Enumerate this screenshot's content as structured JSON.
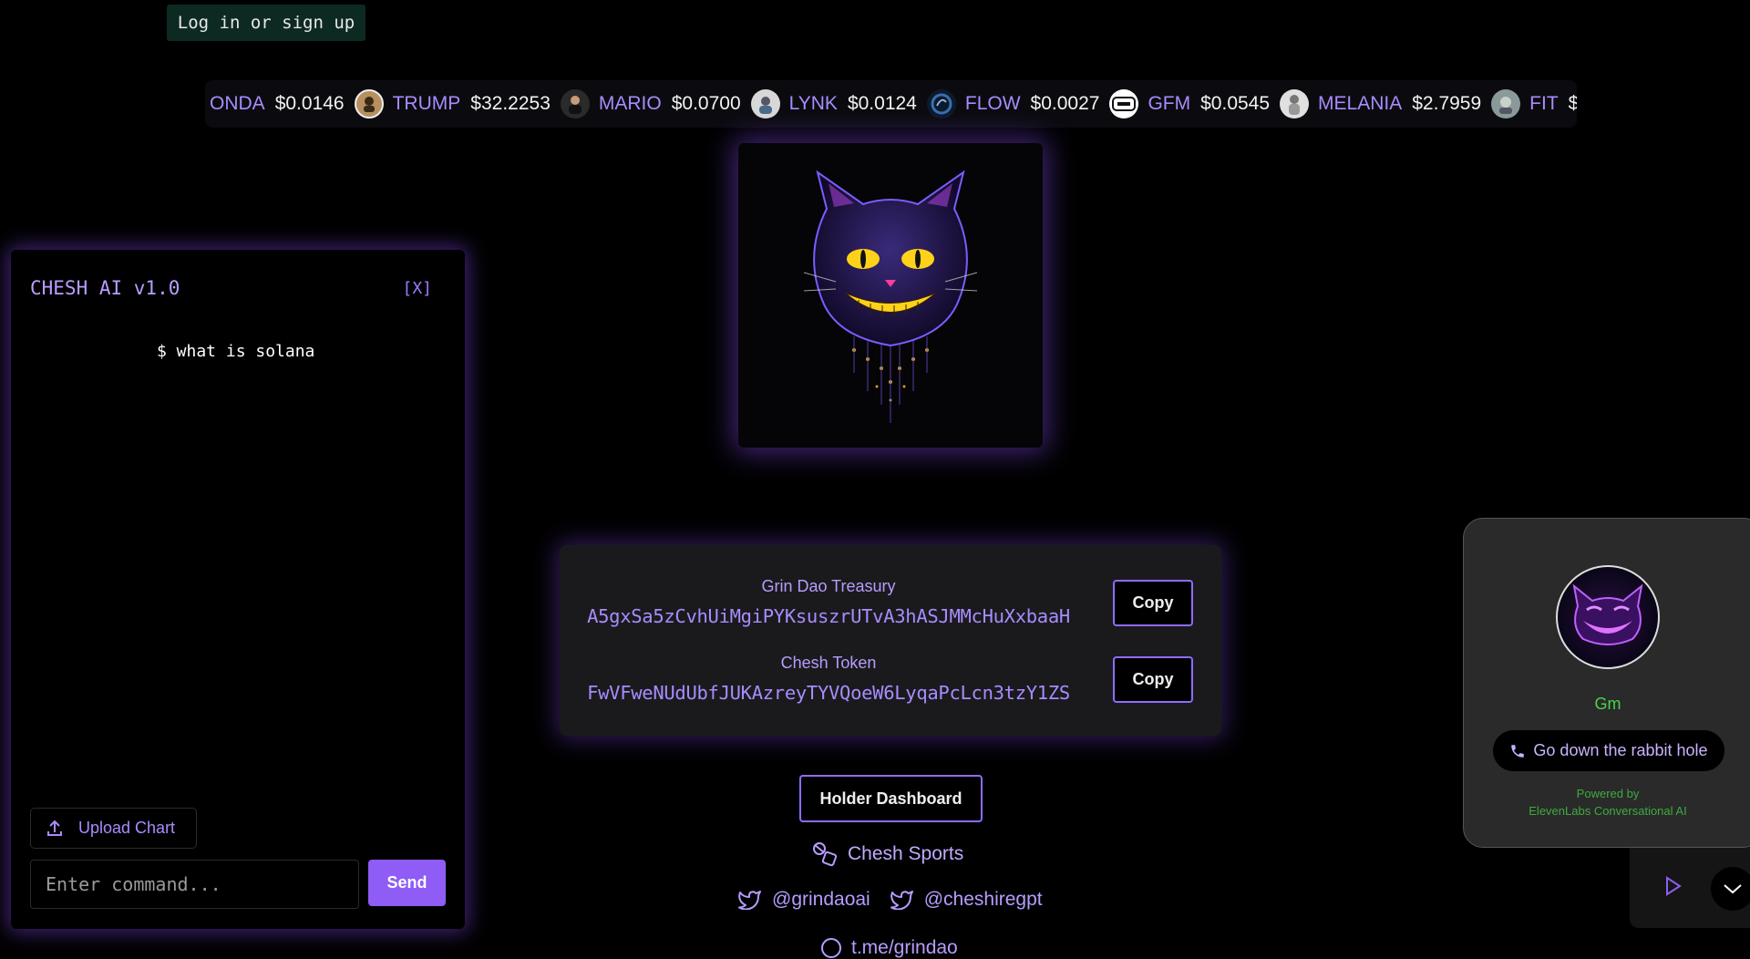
{
  "auth": {
    "login_label": "Log in or sign up"
  },
  "ticker": [
    {
      "symbol": "ONDA",
      "price": "$0.0146",
      "logo": ""
    },
    {
      "symbol": "TRUMP",
      "price": "$32.2253",
      "logo": "trump-token-logo"
    },
    {
      "symbol": "MARIO",
      "price": "$0.0700",
      "logo": "mario-token-logo"
    },
    {
      "symbol": "LYNK",
      "price": "$0.0124",
      "logo": "lynk-token-logo"
    },
    {
      "symbol": "FLOW",
      "price": "$0.0027",
      "logo": "flow-token-logo"
    },
    {
      "symbol": "GFM",
      "price": "$0.0545",
      "logo": "gfm-token-logo"
    },
    {
      "symbol": "MELANIA",
      "price": "$2.7959",
      "logo": "melania-token-logo"
    },
    {
      "symbol": "FIT",
      "price": "$",
      "logo": "fit-token-logo"
    }
  ],
  "chat": {
    "title": "CHESH AI v1.0",
    "close_label": "[X]",
    "messages": [
      "$ what is solana"
    ],
    "upload_label": "Upload Chart",
    "input_placeholder": "Enter command...",
    "send_label": "Send"
  },
  "addresses": {
    "treasury_label": "Grin Dao Treasury",
    "treasury_address": "A5gxSa5zCvhUiMgiPYKsuszrUTvA3hASJMMcHuXxbaaH",
    "token_label": "Chesh Token",
    "token_address": "FwVFweNUdUbfJUKAzreyTYVQoeW6LyqaPcLcn3tzY1ZS",
    "copy_label": "Copy"
  },
  "links": {
    "holder_dashboard": "Holder Dashboard",
    "sports": "Chesh Sports",
    "twitter_1": "@grindaoai",
    "twitter_2": "@cheshiregpt",
    "telegram": "t.me/grindao"
  },
  "voice_widget": {
    "status": "Gm",
    "call_label": "Go down the rabbit hole",
    "powered_line1": "Powered by",
    "powered_line2": "ElevenLabs Conversational AI"
  },
  "colors": {
    "accent": "#8f5cf5",
    "accent_text": "#a98bff",
    "status_green": "#4bd24b"
  }
}
